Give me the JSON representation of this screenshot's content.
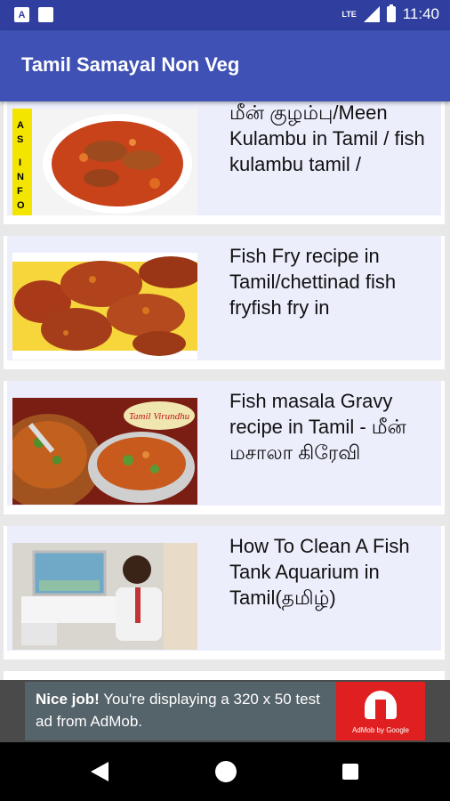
{
  "status_bar": {
    "time": "11:40",
    "network": "LTE",
    "icons": [
      "notification-a-icon",
      "sd-card-icon",
      "signal-icon",
      "battery-icon"
    ]
  },
  "app_bar": {
    "title": "Tamil Samayal Non Veg"
  },
  "items": [
    {
      "title": "மீன் குழம்பு/Meen Kulambu in Tamil / fish kulambu tamil /",
      "thumb": "fish-kulambu-thumbnail"
    },
    {
      "title": "Fish Fry recipe in Tamil/chettinad fish fryfish fry in",
      "thumb": "fish-fry-thumbnail"
    },
    {
      "title": "Fish masala Gravy recipe in Tamil - மீன் மசாலா கிரேவி",
      "thumb": "fish-masala-thumbnail"
    },
    {
      "title": "How To Clean A Fish Tank  Aquarium in Tamil(தமிழ்)",
      "thumb": "fish-tank-thumbnail"
    }
  ],
  "thumb_labels": {
    "info": "AS INFO",
    "brand": "Tamil Virundhu"
  },
  "ad": {
    "bold": "Nice job!",
    "text": " You're displaying a 320 x 50 test ad from AdMob.",
    "logo_text": "AdMob by Google"
  },
  "colors": {
    "status_bar": "#303f9f",
    "app_bar": "#3f51b5",
    "card_bg": "#eceefc",
    "ad_red": "#e02020"
  }
}
